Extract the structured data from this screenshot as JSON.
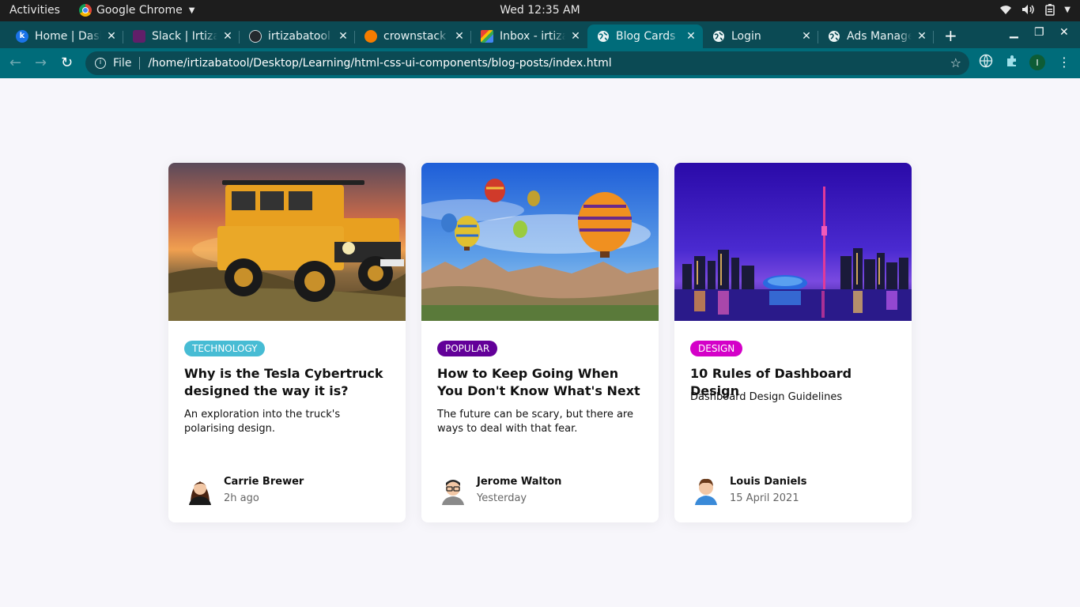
{
  "system_bar": {
    "activities": "Activities",
    "app_name": "Google Chrome",
    "clock": "Wed 12:35 AM"
  },
  "tabs": [
    {
      "label": "Home | Dashboard",
      "icon": "k-app-icon",
      "color": "#1a73e8",
      "active": false
    },
    {
      "label": "Slack | Irtiza",
      "icon": "slack-icon",
      "color": "#611f69",
      "active": false
    },
    {
      "label": "irtizabatool",
      "icon": "github-icon",
      "color": "#24292e",
      "active": false
    },
    {
      "label": "crownstack",
      "icon": "crownstack-icon",
      "color": "#f57c00",
      "active": false
    },
    {
      "label": "Inbox - irtiza",
      "icon": "gmail-icon",
      "color": "#ea4335",
      "active": false
    },
    {
      "label": "Blog Cards",
      "icon": "globe-icon",
      "color": "#e9f3f4",
      "active": true
    },
    {
      "label": "Login",
      "icon": "globe-icon",
      "color": "#e9f3f4",
      "active": false
    },
    {
      "label": "Ads Manager",
      "icon": "globe-icon",
      "color": "#e9f3f4",
      "active": false
    }
  ],
  "address_bar": {
    "scheme": "File",
    "url": "/home/irtizabatool/Desktop/Learning/html-css-ui-components/blog-posts/index.html"
  },
  "profile_initial": "I",
  "cards": [
    {
      "image": "jeep-photo",
      "tag": "Technology",
      "tag_color": "#47bcd4",
      "title": "Why is the Tesla Cybertruck designed the way it is?",
      "description": "An exploration into the truck's polarising design.",
      "author": "Carrie Brewer",
      "time": "2h ago"
    },
    {
      "image": "hot-air-balloons-photo",
      "tag": "Popular",
      "tag_color": "#630099",
      "title": "How to Keep Going When You Don't Know What's Next",
      "description": "The future can be scary, but there are ways to deal with that fear.",
      "author": "Jerome Walton",
      "time": "Yesterday"
    },
    {
      "image": "city-skyline-photo",
      "tag": "Design",
      "tag_color": "#d400c8",
      "title": "10 Rules of Dashboard Design",
      "description": "Dashboard Design Guidelines",
      "author": "Louis Daniels",
      "time": "15 April 2021"
    }
  ]
}
